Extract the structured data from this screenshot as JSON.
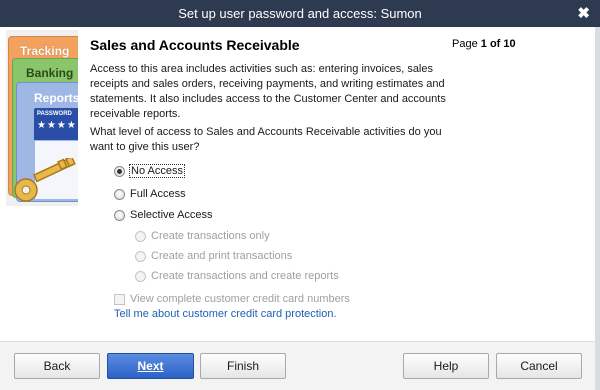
{
  "window": {
    "title": "Set up user password and access: Sumon",
    "close_glyph": "✖"
  },
  "illustration": {
    "tab_tracking": "Tracking",
    "tab_banking": "Banking",
    "tab_reports": "Reports",
    "password_label": "PASSWORD",
    "password_mask": "★★★★",
    "key_icon": "key-icon"
  },
  "content": {
    "heading": "Sales and Accounts Receivable",
    "page_prefix": "Page",
    "page_value": "1 of 10",
    "description": "Access to this area includes activities such as: entering invoices, sales receipts and sales orders, receiving payments, and writing estimates and statements. It also includes access to the Customer Center and accounts receivable reports.",
    "question": "What level of access to Sales and Accounts Receivable activities do you want to give this user?",
    "options": {
      "no_access": "No Access",
      "full_access": "Full Access",
      "selective_access": "Selective Access",
      "create_only": "Create transactions only",
      "create_print": "Create and print transactions",
      "create_reports": "Create transactions and create reports"
    },
    "selected_option": "No Access",
    "checkbox_label": "View complete customer credit card numbers",
    "link_text": "Tell me about customer credit card protection."
  },
  "footer": {
    "back": "Back",
    "next": "Next",
    "finish": "Finish",
    "help": "Help",
    "cancel": "Cancel"
  },
  "colors": {
    "titlebar": "#2e3a4f",
    "primary_button": "#2c62c7",
    "link": "#1f5fb2"
  }
}
